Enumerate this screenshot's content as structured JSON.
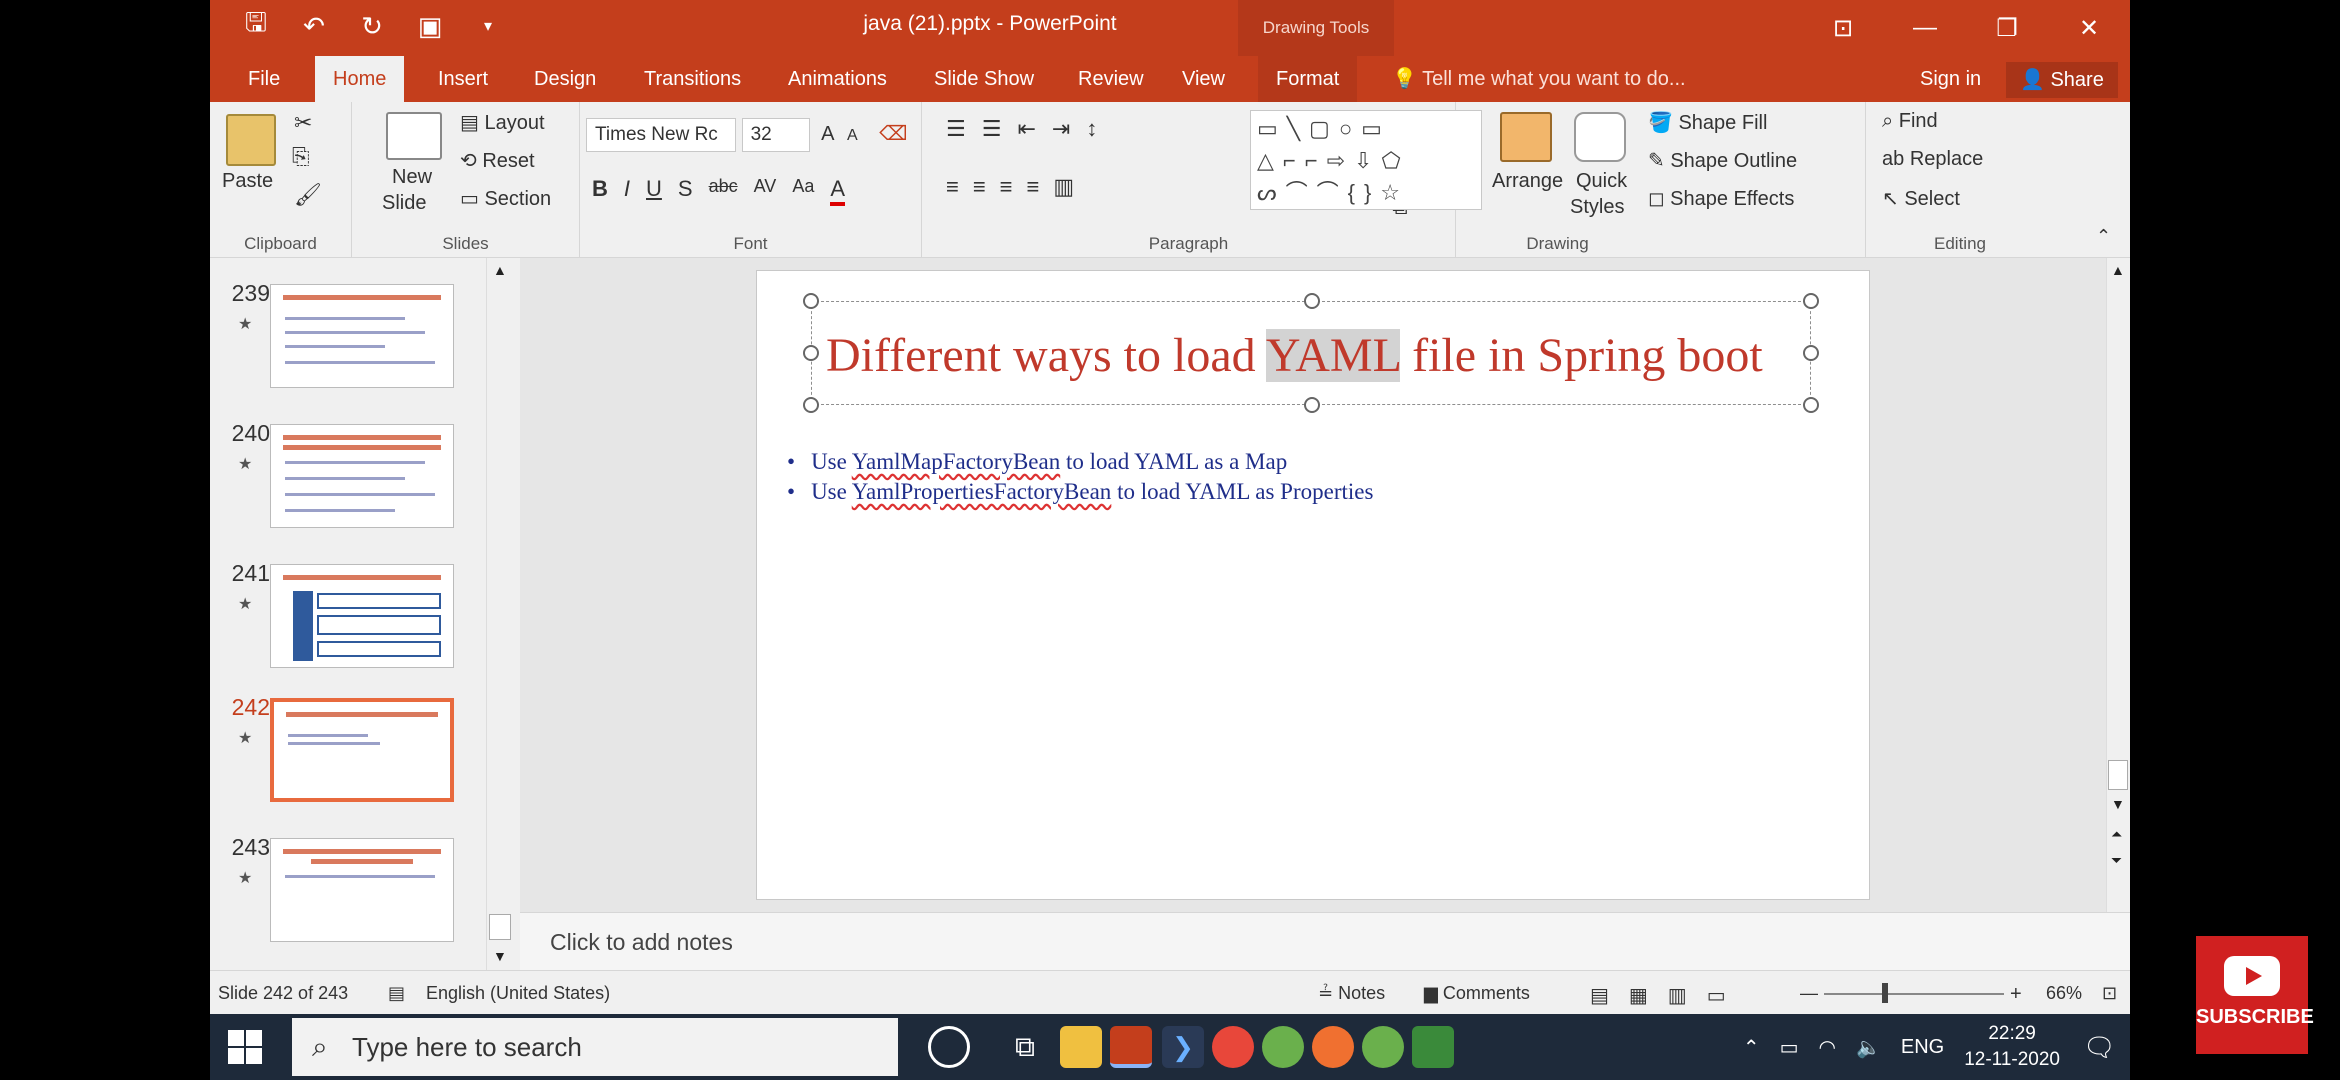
{
  "window": {
    "title": "java (21).pptx - PowerPoint",
    "contextual_tab": "Drawing Tools"
  },
  "tabs": [
    {
      "label": "File"
    },
    {
      "label": "Home"
    },
    {
      "label": "Insert"
    },
    {
      "label": "Design"
    },
    {
      "label": "Transitions"
    },
    {
      "label": "Animations"
    },
    {
      "label": "Slide Show"
    },
    {
      "label": "Review"
    },
    {
      "label": "View"
    },
    {
      "label": "Format"
    }
  ],
  "tell_me": "Tell me what you want to do...",
  "sign_in": "Sign in",
  "share": "Share",
  "ribbon": {
    "clipboard": {
      "paste": "Paste",
      "label": "Clipboard"
    },
    "slides": {
      "new_slide_line1": "New",
      "new_slide_line2": "Slide",
      "layout": "Layout",
      "reset": "Reset",
      "section": "Section",
      "label": "Slides"
    },
    "font": {
      "name": "Times New Rc",
      "size": "32",
      "bold": "B",
      "italic": "I",
      "underline": "U",
      "strike": "S",
      "abc": "abc",
      "av": "AV",
      "aa": "Aa",
      "color_a": "A",
      "label": "Font"
    },
    "paragraph": {
      "label": "Paragraph"
    },
    "drawing": {
      "arrange": "Arrange",
      "quick_styles_line1": "Quick",
      "quick_styles_line2": "Styles",
      "shape_fill": "Shape Fill",
      "shape_outline": "Shape Outline",
      "shape_effects": "Shape Effects",
      "label": "Drawing"
    },
    "editing": {
      "find": "Find",
      "replace": "Replace",
      "select": "Select",
      "label": "Editing"
    }
  },
  "thumbnails": [
    {
      "number": "239",
      "selected": false
    },
    {
      "number": "240",
      "selected": false
    },
    {
      "number": "241",
      "selected": false
    },
    {
      "number": "242",
      "selected": true
    },
    {
      "number": "243",
      "selected": false
    }
  ],
  "slide": {
    "title_pre": "Different ways to load ",
    "title_highlight": "YAML",
    "title_post": " file in Spring boot",
    "bullet1_pre": "Use ",
    "bullet1_link": "YamlMapFactoryBean",
    "bullet1_post": " to load YAML as a Map",
    "bullet2_pre": "Use ",
    "bullet2_link": "YamlPropertiesFactoryBean",
    "bullet2_post": " to load YAML as Properties"
  },
  "notes_placeholder": "Click to add notes",
  "status": {
    "slide_info": "Slide 242 of 243",
    "language": "English (United States)",
    "notes": "Notes",
    "comments": "Comments",
    "zoom": "66%"
  },
  "taskbar": {
    "search_placeholder": "Type here to search",
    "lang": "ENG",
    "time": "22:29",
    "date": "12-11-2020"
  },
  "overlay": {
    "subscribe": "SUBSCRIBE"
  },
  "colors": {
    "accent": "#c43e1c",
    "title_red": "#c0392b",
    "bullet_blue": "#1f2e8a"
  }
}
